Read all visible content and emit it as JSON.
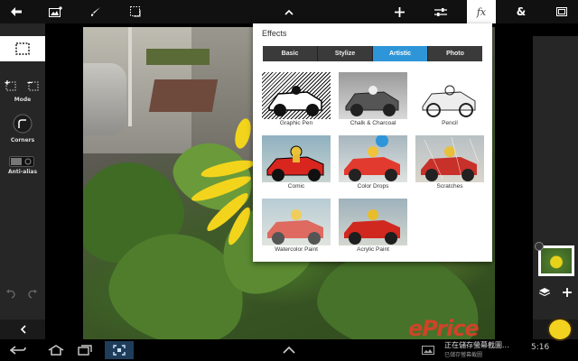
{
  "top_bar": {
    "icons": [
      "back-arrow-icon",
      "add-image-icon",
      "brush-icon",
      "crop-icon",
      "chevron-up-icon",
      "plus-icon",
      "sliders-icon",
      "fx-icon",
      "ampersand-icon",
      "fullscreen-icon"
    ],
    "fx_label": "fx",
    "ampersand_label": "&"
  },
  "left_panel": {
    "mode_label": "Mode",
    "corners_label": "Corners",
    "antialias_label": "Anti-alias"
  },
  "effects_panel": {
    "title": "Effects",
    "tabs": [
      {
        "label": "Basic",
        "selected": false
      },
      {
        "label": "Stylize",
        "selected": false
      },
      {
        "label": "Artistic",
        "selected": true
      },
      {
        "label": "Photo",
        "selected": false
      }
    ],
    "items": [
      {
        "label": "Graphic Pen"
      },
      {
        "label": "Chalk & Charcoal"
      },
      {
        "label": "Pencil"
      },
      {
        "label": "Comic"
      },
      {
        "label": "Color Drops"
      },
      {
        "label": "Scratches"
      },
      {
        "label": "Watercolor Paint"
      },
      {
        "label": "Acrylic Paint"
      }
    ],
    "selected_tab_color": "#2e96d8"
  },
  "status_bar": {
    "notification_title": "正在儲存螢幕截圖...",
    "notification_sub": "已儲存螢幕截圖",
    "time": "5:16",
    "watermark": "ePrice"
  }
}
